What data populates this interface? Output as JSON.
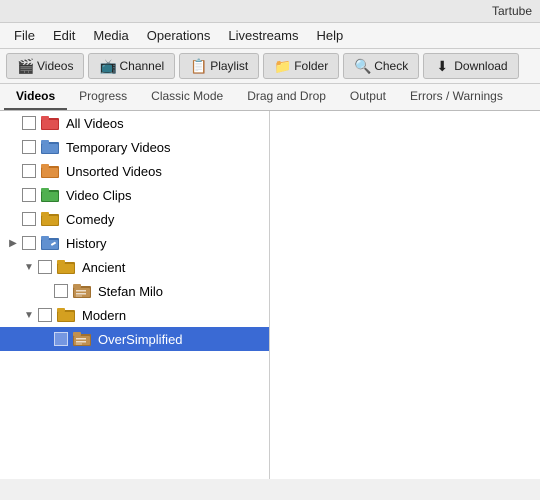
{
  "titlebar": {
    "title": "Tartube"
  },
  "menubar": {
    "items": [
      {
        "id": "file",
        "label": "File"
      },
      {
        "id": "edit",
        "label": "Edit"
      },
      {
        "id": "media",
        "label": "Media"
      },
      {
        "id": "operations",
        "label": "Operations"
      },
      {
        "id": "livestreams",
        "label": "Livestreams"
      },
      {
        "id": "help",
        "label": "Help"
      }
    ]
  },
  "toolbar": {
    "buttons": [
      {
        "id": "videos",
        "label": "Videos",
        "icon": "film"
      },
      {
        "id": "channel",
        "label": "Channel",
        "icon": "channel"
      },
      {
        "id": "playlist",
        "label": "Playlist",
        "icon": "playlist"
      },
      {
        "id": "folder",
        "label": "Folder",
        "icon": "folder"
      },
      {
        "id": "check",
        "label": "Check",
        "icon": "check"
      },
      {
        "id": "download",
        "label": "Download",
        "icon": "download"
      }
    ]
  },
  "tabs": [
    {
      "id": "videos",
      "label": "Videos",
      "active": true
    },
    {
      "id": "progress",
      "label": "Progress",
      "active": false
    },
    {
      "id": "classic-mode",
      "label": "Classic Mode",
      "active": false
    },
    {
      "id": "drag-and-drop",
      "label": "Drag and Drop",
      "active": false
    },
    {
      "id": "output",
      "label": "Output",
      "active": false
    },
    {
      "id": "errors-warnings",
      "label": "Errors / Warnings",
      "active": false
    }
  ],
  "tree": {
    "items": [
      {
        "id": "all-videos",
        "label": "All Videos",
        "indent": 0,
        "folder": "red",
        "expand": "",
        "selected": false
      },
      {
        "id": "temporary-videos",
        "label": "Temporary Videos",
        "indent": 0,
        "folder": "blue-open",
        "expand": "",
        "selected": false
      },
      {
        "id": "unsorted-videos",
        "label": "Unsorted Videos",
        "indent": 0,
        "folder": "orange",
        "expand": "",
        "selected": false
      },
      {
        "id": "video-clips",
        "label": "Video Clips",
        "indent": 0,
        "folder": "green",
        "expand": "",
        "selected": false
      },
      {
        "id": "comedy",
        "label": "Comedy",
        "indent": 0,
        "folder": "yellow",
        "expand": "",
        "selected": false
      },
      {
        "id": "history",
        "label": "History",
        "indent": 0,
        "folder": "blue-edit",
        "expand": "▶",
        "selected": false
      },
      {
        "id": "ancient",
        "label": "Ancient",
        "indent": 1,
        "folder": "yellow-open",
        "expand": "▼",
        "selected": false
      },
      {
        "id": "stefan-milo",
        "label": "Stefan Milo",
        "indent": 2,
        "folder": "list",
        "expand": "",
        "selected": false
      },
      {
        "id": "modern",
        "label": "Modern",
        "indent": 1,
        "folder": "yellow-open",
        "expand": "▼",
        "selected": false
      },
      {
        "id": "oversimplified",
        "label": "OverSimplified",
        "indent": 2,
        "folder": "list",
        "expand": "",
        "selected": true
      }
    ]
  }
}
